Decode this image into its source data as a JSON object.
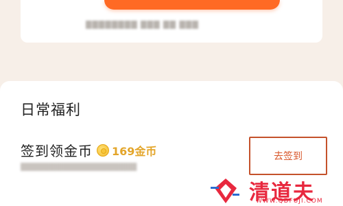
{
  "top": {
    "hint_text": "████████ ███ ██ ███"
  },
  "daily_benefits": {
    "title": "日常福利",
    "task": {
      "name": "签到领金币",
      "reward_amount": "169金币",
      "description": "████████████████████",
      "button_label": "去签到"
    }
  },
  "watermark": {
    "brand": "清道夫",
    "url": "WWW.QDFUJI.COM"
  },
  "colors": {
    "accent": "#ff6a24",
    "coin": "#f3b92a",
    "button_text": "#d8562a",
    "watermark": "#e8283e"
  }
}
